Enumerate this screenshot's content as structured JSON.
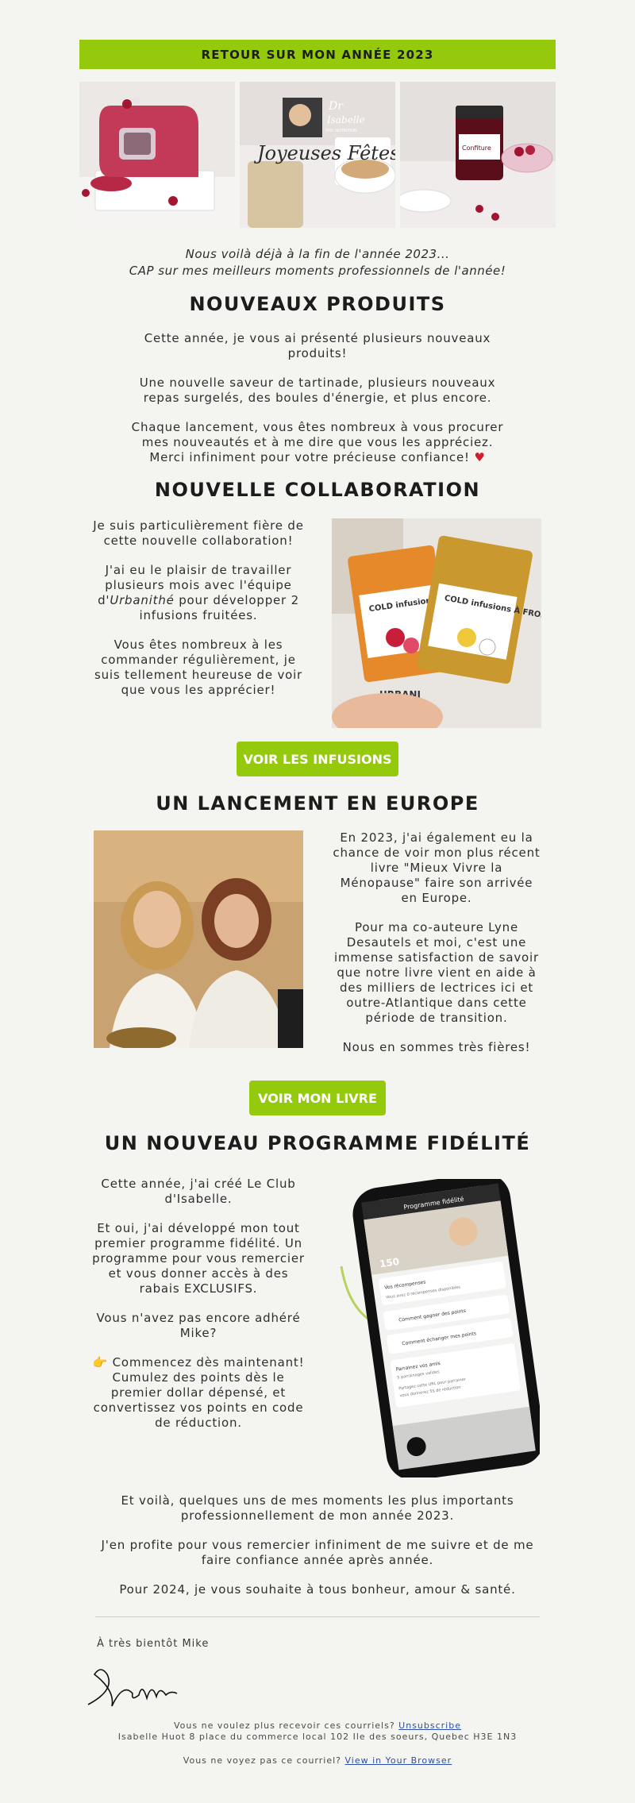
{
  "banner": {
    "title": "RETOUR SUR MON ANNÉE 2023"
  },
  "hero": {
    "logo_line1": "Dr",
    "logo_line2": "Isabelle",
    "logo_line3": "PHD NUTRITION",
    "script_small": "Joyeuses",
    "script_large": "Joyeuses Fêtes",
    "jar_label": "Confiture"
  },
  "intro": {
    "line1": "Nous voilà déjà à la fin de l'année 2023...",
    "line2": "CAP sur mes meilleurs moments professionnels de l'année!"
  },
  "produits": {
    "title": "NOUVEAUX PRODUITS",
    "p1": "Cette année, je vous ai présenté plusieurs nouveaux produits!",
    "p2": "Une nouvelle saveur de tartinade, plusieurs nouveaux repas surgelés, des boules d'énergie, et plus encore.",
    "p3": "Chaque lancement, vous êtes nombreux à vous procurer mes nouveautés et à me dire que vous les appréciez. Merci infiniment pour votre précieuse confiance!",
    "heart": "♥"
  },
  "collab": {
    "title": "NOUVELLE COLLABORATION",
    "p1": "Je suis particulièrement fière de cette nouvelle collaboration!",
    "p2a": "J'ai eu le plaisir de travailler plusieurs mois avec l'équipe d'",
    "p2b": "Urbanithé",
    "p2c": " pour développer 2 infusions fruitées.",
    "p3": "Vous êtes nombreux à les commander régulièrement, je suis tellement heureuse de voir que vous les apprécier!",
    "button": "VOIR LES INFUSIONS",
    "pack1": "COLD infusions À FROID",
    "pack2": "COLD infusions À FROID",
    "brand": "URBANI"
  },
  "europe": {
    "title": "UN LANCEMENT EN EUROPE",
    "p1": "En 2023, j'ai également eu la chance de voir mon plus récent livre \"Mieux Vivre la Ménopause\" faire son arrivée en Europe.",
    "p2": "Pour ma co-auteure Lyne Desautels et moi, c'est une immense satisfaction de savoir que notre livre vient en aide à des milliers de lectrices ici et outre-Atlantique dans cette période de transition.",
    "p3": "Nous en sommes très fières!",
    "button": "VOIR MON LIVRE"
  },
  "fidelite": {
    "title": "UN NOUVEAU PROGRAMME FIDÉLITÉ",
    "p1": "Cette année, j'ai créé Le Club d'Isabelle.",
    "p2": "Et oui, j'ai développé mon tout premier programme fidélité. Un programme pour vous remercier et vous donner accès à des rabais EXCLUSIFS.",
    "p3": "Vous n'avez pas encore adhéré Mike?",
    "p4_icon": "👉",
    "p4": "Commencez dès maintenant! Cumulez des points dès le premier dollar dépensé, et convertissez vos points en code de réduction.",
    "phone_header": "Programme fidélité",
    "phone_points": "150",
    "phone_row1": "Vos récompenses",
    "phone_row1_sub": "Vous avez 0 récompenses disponibles",
    "phone_row2": "Comment gagner des points",
    "phone_row3": "Comment échanger mes points",
    "phone_row4": "Parrainez vos amis",
    "phone_row4_sub": "5 parrainages valides",
    "phone_row5": "Partagez cette URL pour parrainer",
    "phone_row6": "vous donnerez 5$ de réduction"
  },
  "closing": {
    "p1": "Et voilà, quelques uns de mes moments les plus importants professionnellement de mon année 2023.",
    "p2": "J'en profite pour vous remercier infiniment de me suivre et de me faire confiance année après année.",
    "p3": "Pour 2024, je vous souhaite à tous bonheur, amour & santé.",
    "signoff": "À très bientôt Mike",
    "signature": "Isabelle"
  },
  "footer": {
    "unsub_text": "Vous ne voulez plus recevoir ces courriels? ",
    "unsub_link": "Unsubscribe",
    "address": "Isabelle Huot 8 place du commerce local 102 Ile des soeurs, Quebec H3E 1N3",
    "browser_text": "Vous ne voyez pas ce courriel? ",
    "browser_link": "View in Your Browser"
  },
  "colors": {
    "accent": "#95c90c",
    "background": "#f4f4f0",
    "heart": "#d51b2e"
  }
}
